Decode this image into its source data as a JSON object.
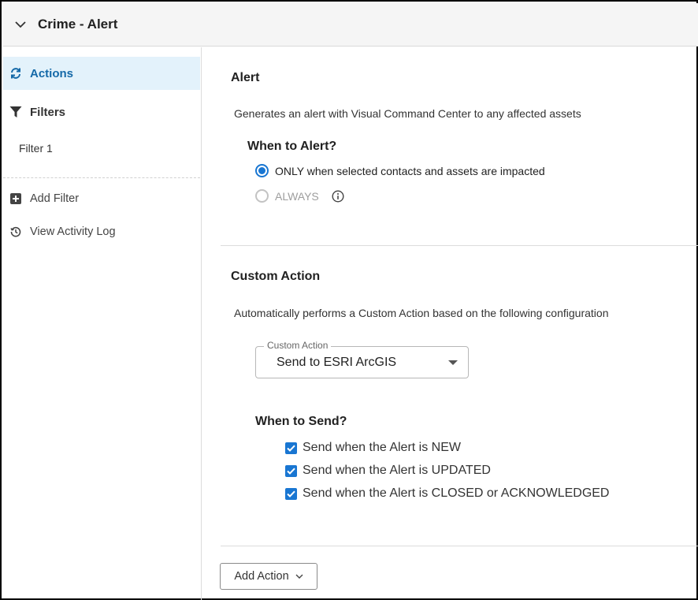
{
  "header": {
    "title": "Crime - Alert",
    "collapse_icon": "chevron-down-icon"
  },
  "sidebar": {
    "items": [
      {
        "label": "Actions",
        "icon": "sync-icon",
        "active": true
      },
      {
        "label": "Filters",
        "icon": "filter-icon"
      },
      {
        "label": "Filter 1"
      },
      {
        "label": "Add Filter",
        "icon": "plus-square-icon"
      },
      {
        "label": "View Activity Log",
        "icon": "history-icon"
      }
    ]
  },
  "alert_section": {
    "title": "Alert",
    "description": "Generates an alert with Visual Command Center to any affected assets",
    "when_title": "When to Alert?",
    "options": [
      {
        "label": "ONLY when selected contacts and assets are impacted",
        "selected": true
      },
      {
        "label": "ALWAYS",
        "selected": false,
        "disabled": true
      }
    ]
  },
  "custom_action_section": {
    "title": "Custom Action",
    "description": "Automatically performs a Custom Action based on the following configuration",
    "select": {
      "legend": "Custom Action",
      "value": "Send to ESRI ArcGIS"
    },
    "when_title": "When to Send?",
    "checks": [
      {
        "label": "Send when the Alert is NEW",
        "checked": true
      },
      {
        "label": "Send when the Alert is UPDATED",
        "checked": true
      },
      {
        "label": "Send when the Alert is CLOSED or ACKNOWLEDGED",
        "checked": true
      }
    ]
  },
  "footer": {
    "add_action_label": "Add Action"
  },
  "colors": {
    "accent": "#1976d2",
    "active_bg": "#e3f2fb",
    "active_text": "#1469a8"
  }
}
